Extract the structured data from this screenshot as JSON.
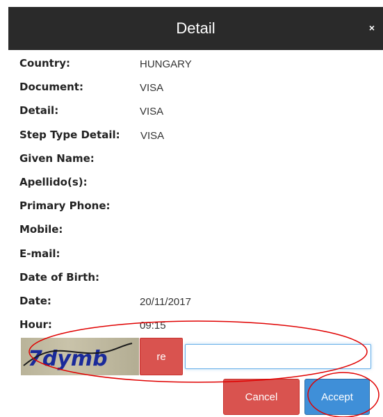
{
  "dialog": {
    "title": "Detail",
    "close_label": "×"
  },
  "fields": [
    {
      "label": "Country:",
      "value": "HUNGARY"
    },
    {
      "label": "Document:",
      "value": "VISA"
    },
    {
      "label": "Detail:",
      "value": "VISA"
    },
    {
      "label": "Step Type Detail:",
      "value": "VISA"
    },
    {
      "label": "Given Name:",
      "value": ""
    },
    {
      "label": "Apellido(s):",
      "value": ""
    },
    {
      "label": "Primary Phone:",
      "value": ""
    },
    {
      "label": "Mobile:",
      "value": ""
    },
    {
      "label": "E-mail:",
      "value": ""
    },
    {
      "label": "Date of Birth:",
      "value": ""
    },
    {
      "label": "Date:",
      "value": "20/11/2017"
    },
    {
      "label": "Hour:",
      "value": "09:15"
    }
  ],
  "captcha": {
    "image_text": "7dymb",
    "refresh_label": "re",
    "input_value": "",
    "input_placeholder": ""
  },
  "actions": {
    "cancel_label": "Cancel",
    "accept_label": "Accept"
  },
  "colors": {
    "header_bg": "#2a2a2a",
    "danger": "#d9534f",
    "primary": "#3f8fd8",
    "annotation": "#e00000"
  }
}
